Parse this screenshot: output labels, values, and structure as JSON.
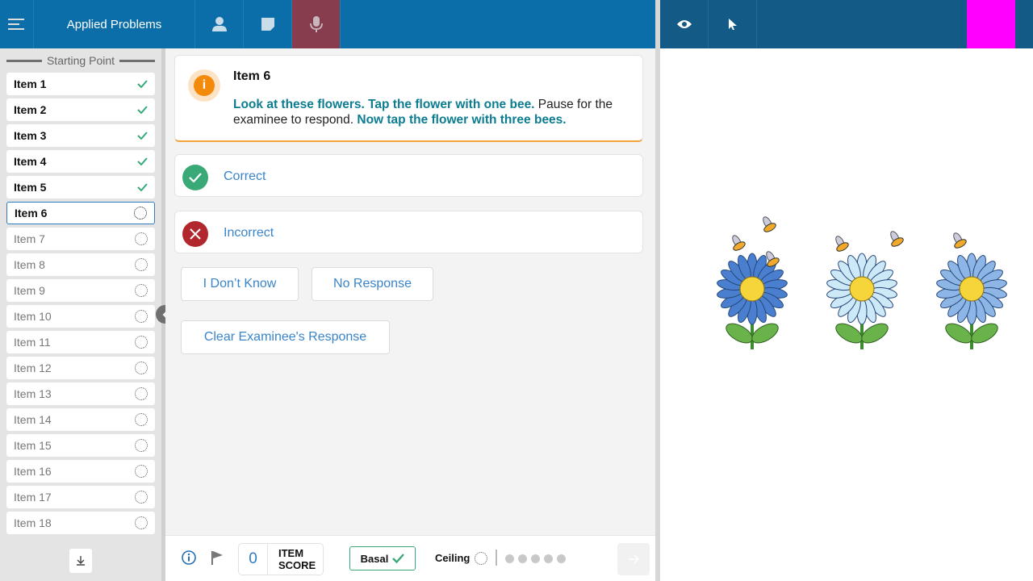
{
  "header": {
    "title": "Applied Problems",
    "icons": [
      "menu-icon",
      "person-icon",
      "note-icon",
      "microphone-icon"
    ],
    "right_icons": [
      "eye-icon",
      "cursor-icon"
    ],
    "active_color": "#873d4e",
    "marker_color": "#ff00ff"
  },
  "sidebar": {
    "starting_point": "Starting Point",
    "items": [
      {
        "label": "Item 1",
        "status": "done"
      },
      {
        "label": "Item 2",
        "status": "done"
      },
      {
        "label": "Item 3",
        "status": "done"
      },
      {
        "label": "Item 4",
        "status": "done"
      },
      {
        "label": "Item 5",
        "status": "done"
      },
      {
        "label": "Item 6",
        "status": "current"
      },
      {
        "label": "Item 7",
        "status": "pending"
      },
      {
        "label": "Item 8",
        "status": "pending"
      },
      {
        "label": "Item 9",
        "status": "pending"
      },
      {
        "label": "Item 10",
        "status": "pending"
      },
      {
        "label": "Item 11",
        "status": "pending"
      },
      {
        "label": "Item 12",
        "status": "pending"
      },
      {
        "label": "Item 13",
        "status": "pending"
      },
      {
        "label": "Item 14",
        "status": "pending"
      },
      {
        "label": "Item 15",
        "status": "pending"
      },
      {
        "label": "Item 16",
        "status": "pending"
      },
      {
        "label": "Item 17",
        "status": "pending"
      },
      {
        "label": "Item 18",
        "status": "pending"
      }
    ]
  },
  "prompt": {
    "title": "Item 6",
    "bold1": "Look at these flowers. Tap the flower with one bee.",
    "normal": " Pause for the examinee to respond. ",
    "bold2": "Now tap the flower with three bees."
  },
  "responses": {
    "correct": "Correct",
    "incorrect": "Incorrect",
    "dont_know": "I Don’t Know",
    "no_response": "No Response",
    "clear": "Clear Examinee's Response"
  },
  "footer": {
    "score": "0",
    "score_label1": "ITEM",
    "score_label2": "SCORE",
    "basal": "Basal",
    "ceiling": "Ceiling"
  },
  "stimulus": {
    "flowers": [
      {
        "color": "#4a7fd0",
        "bees": 3
      },
      {
        "color": "#cde8f7",
        "bees": 2
      },
      {
        "color": "#8db6e6",
        "bees": 1
      }
    ]
  }
}
